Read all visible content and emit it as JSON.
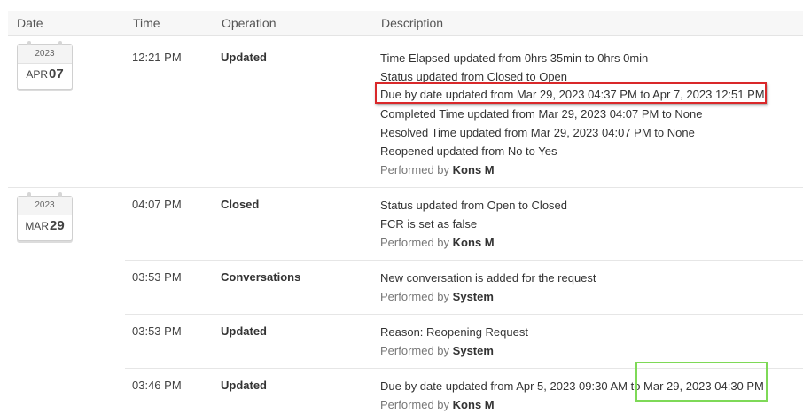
{
  "columns": {
    "date": "Date",
    "time": "Time",
    "operation": "Operation",
    "description": "Description"
  },
  "groups": [
    {
      "year": "2023",
      "month": "APR",
      "day": "07",
      "entries": [
        {
          "time": "12:21 PM",
          "operation": "Updated",
          "lines": [
            "Time Elapsed updated from 0hrs 35min to 0hrs 0min",
            "Status updated from Closed to Open",
            "Due by date updated from Mar 29, 2023 04:37 PM to Apr 7, 2023 12:51 PM",
            "Completed Time updated from Mar 29, 2023 04:07 PM to None",
            "Resolved Time updated from Mar 29, 2023 04:07 PM to None",
            "Reopened updated from No to Yes"
          ],
          "performed_label": "Performed by",
          "performed_by": "Kons M"
        }
      ]
    },
    {
      "year": "2023",
      "month": "MAR",
      "day": "29",
      "entries": [
        {
          "time": "04:07 PM",
          "operation": "Closed",
          "lines": [
            "Status updated from Open to Closed",
            "FCR is set as false"
          ],
          "performed_label": "Performed by",
          "performed_by": "Kons M"
        },
        {
          "time": "03:53 PM",
          "operation": "Conversations",
          "lines": [
            "New conversation is added for the request"
          ],
          "performed_label": "Performed by",
          "performed_by": "System"
        },
        {
          "time": "03:53 PM",
          "operation": "Updated",
          "lines": [
            "Reason: Reopening Request"
          ],
          "performed_label": "Performed by",
          "performed_by": "System"
        },
        {
          "time": "03:46 PM",
          "operation": "Updated",
          "lines": [
            "Due by date updated from Apr 5, 2023 09:30 AM to Mar 29, 2023 04:30 PM"
          ],
          "performed_label": "Performed by",
          "performed_by": "Kons M"
        }
      ]
    }
  ],
  "colors": {
    "highlight_red": "#d9282a",
    "highlight_green": "#7ed957"
  }
}
